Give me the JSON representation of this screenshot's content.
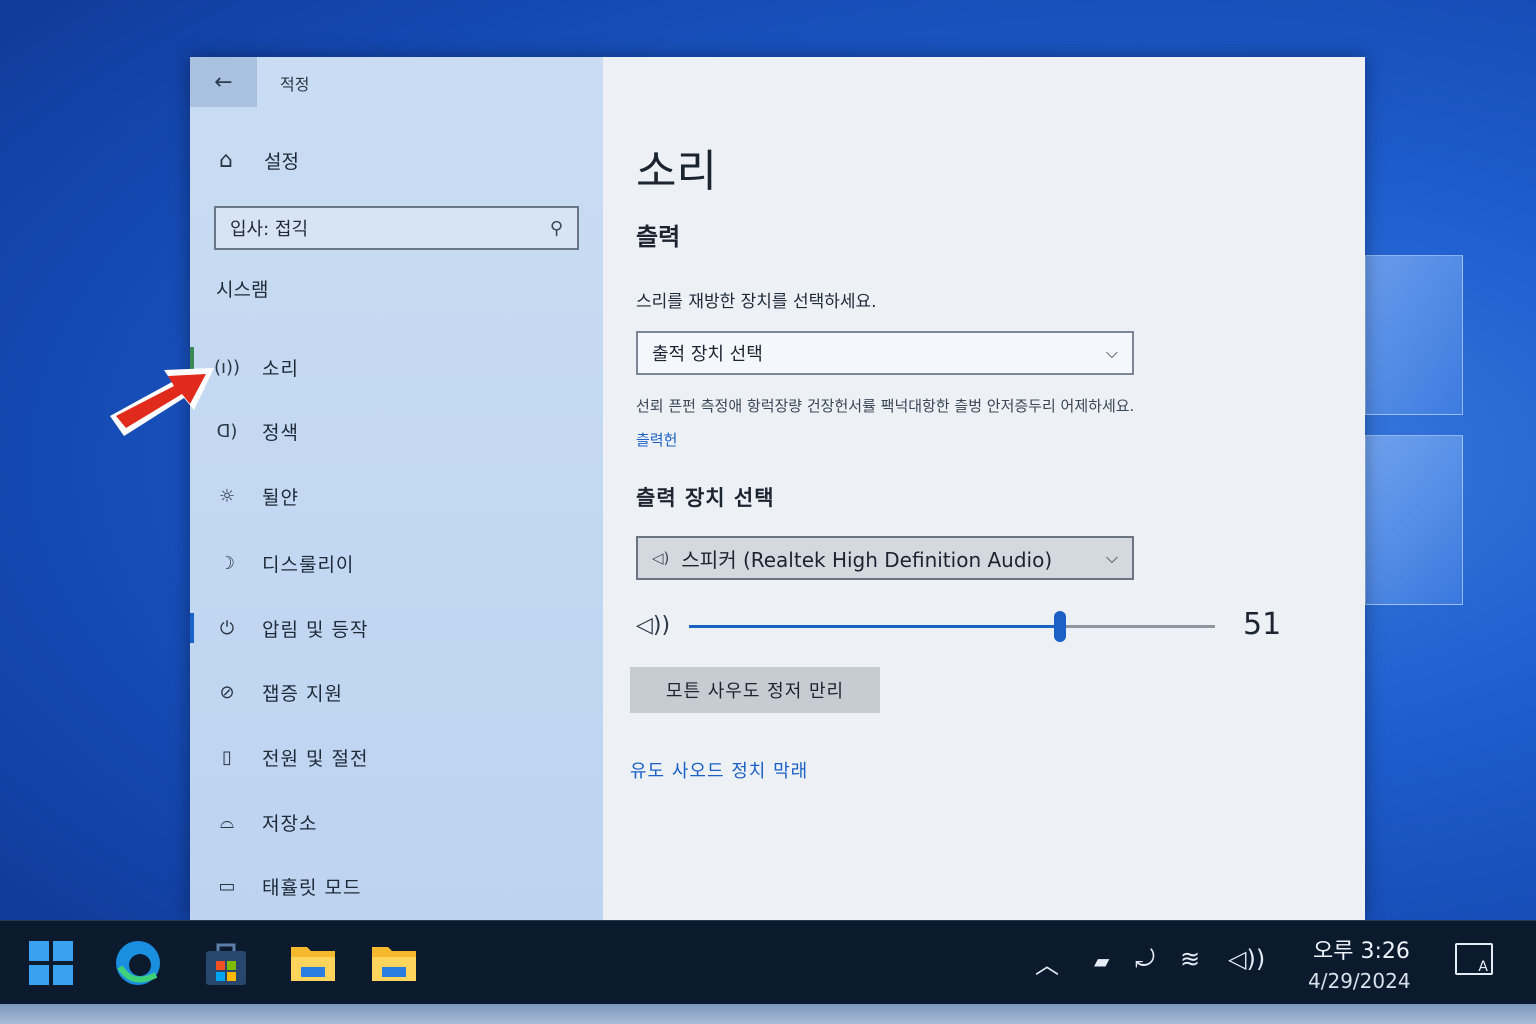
{
  "window": {
    "title": "적정",
    "back_glyph": "←",
    "controls": {
      "minimize": "—",
      "maximize": "☐",
      "close": "✕"
    }
  },
  "sidebar": {
    "home_label": "설정",
    "search": {
      "value": "입사: 접긱",
      "placeholder": ""
    },
    "section_label": "시스램",
    "items": [
      {
        "label": "소리",
        "icon": "speaker-waves-icon",
        "glyph": "(ı))"
      },
      {
        "label": "정색",
        "icon": "speaker-icon",
        "glyph": "ᗡ)"
      },
      {
        "label": "뒬얀",
        "icon": "sun-icon",
        "glyph": "☼"
      },
      {
        "label": "디스룰리이",
        "icon": "moon-icon",
        "glyph": "☽"
      },
      {
        "label": "압림 및 등작",
        "icon": "power-icon",
        "glyph": "⏻"
      },
      {
        "label": "잽증 지원",
        "icon": "no-entry-icon",
        "glyph": "⊘"
      },
      {
        "label": "전원 및 절전",
        "icon": "battery-icon",
        "glyph": "▯"
      },
      {
        "label": "저장소",
        "icon": "drive-icon",
        "glyph": "⌓"
      },
      {
        "label": "태휼릿 모드",
        "icon": "tablet-icon",
        "glyph": "▭"
      }
    ]
  },
  "main": {
    "title": "소리",
    "output_heading": "츨력",
    "output_desc": "스리를 재방한 장치를 선택하세요.",
    "output_dropdown": "출적 장치 선택",
    "note": "선뢰 픈펀 측정애 항럭장량 건장헌서률 팩넉대항한 츨벙 안저증두리 어제하세요.",
    "note_link": "츨력헌",
    "device_heading": "츨력 장치 선택",
    "device_dropdown": "스피커 (Realtek High Definition Audio)",
    "volume": 51,
    "volume_label": "51",
    "manage_button": "모튼 사우도 정저 만리",
    "bottom_link": "유도 사오드 정치 막래"
  },
  "taskbar": {
    "time": "오루 3:26",
    "date": "4/29/2024"
  },
  "colors": {
    "accent": "#1b61c5",
    "taskbar": "#0c1a2e",
    "arrow": "#e02a1c"
  }
}
